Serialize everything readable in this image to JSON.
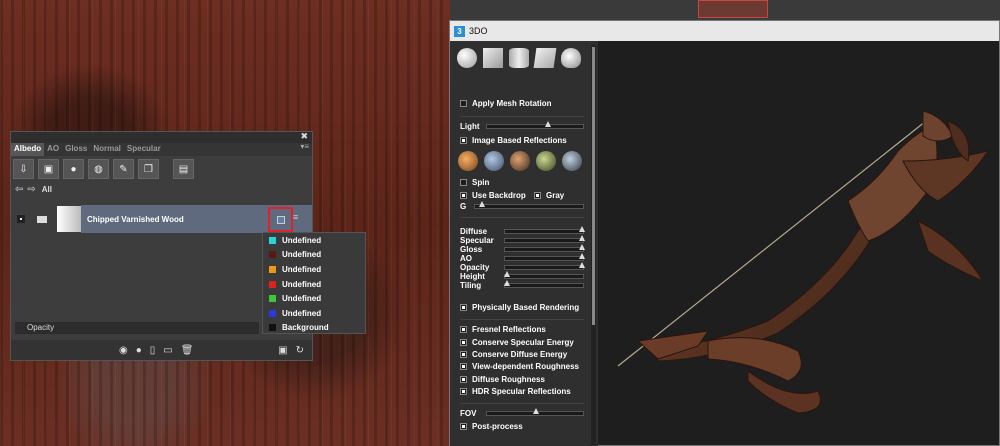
{
  "texture_panel": {
    "close_glyph": "✖",
    "tabs": [
      {
        "label": "Albedo",
        "active": true
      },
      {
        "label": "AO",
        "active": false
      },
      {
        "label": "Gloss",
        "active": false
      },
      {
        "label": "Normal",
        "active": false
      },
      {
        "label": "Specular",
        "active": false
      }
    ],
    "nav_all": "All",
    "material_name": "Chipped Varnished Wood",
    "opacity_label": "Opacity"
  },
  "dropdown": {
    "items": [
      {
        "label": "Undefined",
        "color": "#2ad4d8"
      },
      {
        "label": "Undefined",
        "color": "#5a1a14"
      },
      {
        "label": "Undefined",
        "color": "#e89a1c"
      },
      {
        "label": "Undefined",
        "color": "#e02020"
      },
      {
        "label": "Undefined",
        "color": "#38c838"
      },
      {
        "label": "Undefined",
        "color": "#2a3ad8"
      },
      {
        "label": "Background",
        "color": "#111111"
      }
    ]
  },
  "window_3do": {
    "title": "3DO",
    "app_icon_letter": "3",
    "apply_mesh_rotation": "Apply Mesh Rotation",
    "light_label": "Light",
    "image_based_reflections": "Image Based Reflections",
    "spin": "Spin",
    "use_backdrop": "Use Backdrop",
    "gray": "Gray",
    "g_label": "G",
    "channels": [
      {
        "label": "Diffuse",
        "value": 1.0
      },
      {
        "label": "Specular",
        "value": 1.0
      },
      {
        "label": "Gloss",
        "value": 1.0
      },
      {
        "label": "AO",
        "value": 1.0
      },
      {
        "label": "Opacity",
        "value": 1.0
      },
      {
        "label": "Height",
        "value": 0.0
      },
      {
        "label": "Tiling",
        "value": 0.0
      }
    ],
    "physically_based_rendering": "Physically Based Rendering",
    "checkboxes": [
      "Fresnel Reflections",
      "Conserve Specular Energy",
      "Conserve Diffuse Energy",
      "View-dependent Roughness",
      "Diffuse Roughness",
      "HDR Specular Reflections"
    ],
    "fov_label": "FOV",
    "post_process": "Post-process"
  }
}
